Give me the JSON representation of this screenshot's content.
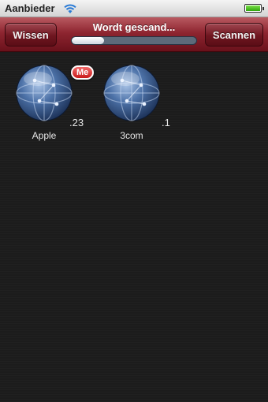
{
  "status_bar": {
    "carrier": "Aanbieder",
    "wifi_icon": "wifi-icon",
    "battery_icon": "battery-icon",
    "battery_level": 1.0
  },
  "toolbar": {
    "left_button": "Wissen",
    "title": "Wordt gescand...",
    "right_button": "Scannen",
    "progress": 0.26
  },
  "devices": [
    {
      "name": "Apple",
      "ip_suffix": ".23",
      "badge": "Me",
      "icon": "globe-icon"
    },
    {
      "name": "3com",
      "ip_suffix": ".1",
      "badge": "",
      "icon": "globe-icon"
    }
  ],
  "colors": {
    "toolbar_accent": "#8e2530",
    "background": "#1c1c1c",
    "badge": "#d42a2a"
  }
}
